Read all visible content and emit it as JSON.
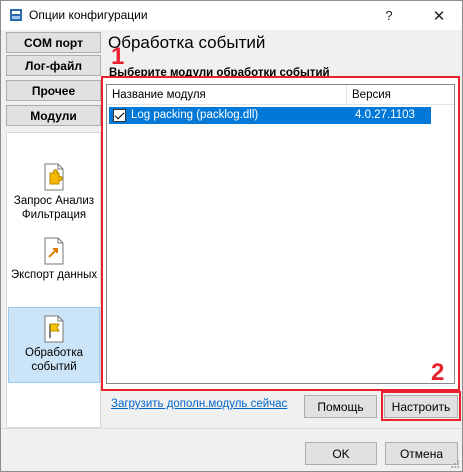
{
  "window": {
    "title": "Опции конфигурации",
    "help_glyph": "?",
    "close_glyph": "✕"
  },
  "nav": {
    "buttons": [
      "COM порт",
      "Лог-файл",
      "Прочее",
      "Модули"
    ],
    "items": [
      {
        "label": "Запрос Анализ Фильтрация",
        "icon": "puzzle-document-icon"
      },
      {
        "label": "Экспорт данных",
        "icon": "document-export-icon"
      },
      {
        "label": "Обработка событий",
        "icon": "flag-document-icon",
        "selected": true
      }
    ]
  },
  "main": {
    "title": "Обработка событий",
    "hint": "Выберите модули обработки событий",
    "table": {
      "columns": [
        "Название модуля",
        "Версия"
      ],
      "rows": [
        {
          "checked": true,
          "name": "Log packing (packlog.dll)",
          "version": "4.0.27.1103",
          "selected": true
        }
      ]
    },
    "link": "Загрузить дополн.модуль сейчас",
    "help_button": "Помощь",
    "config_button": "Настроить"
  },
  "annotations": {
    "label_1": "1",
    "label_2": "2",
    "color": "#e8212f"
  },
  "footer": {
    "ok": "OK",
    "cancel": "Отмена"
  },
  "colors": {
    "selection": "#0078d7",
    "nav_selected": "#cce4f7",
    "link": "#0066cc"
  }
}
